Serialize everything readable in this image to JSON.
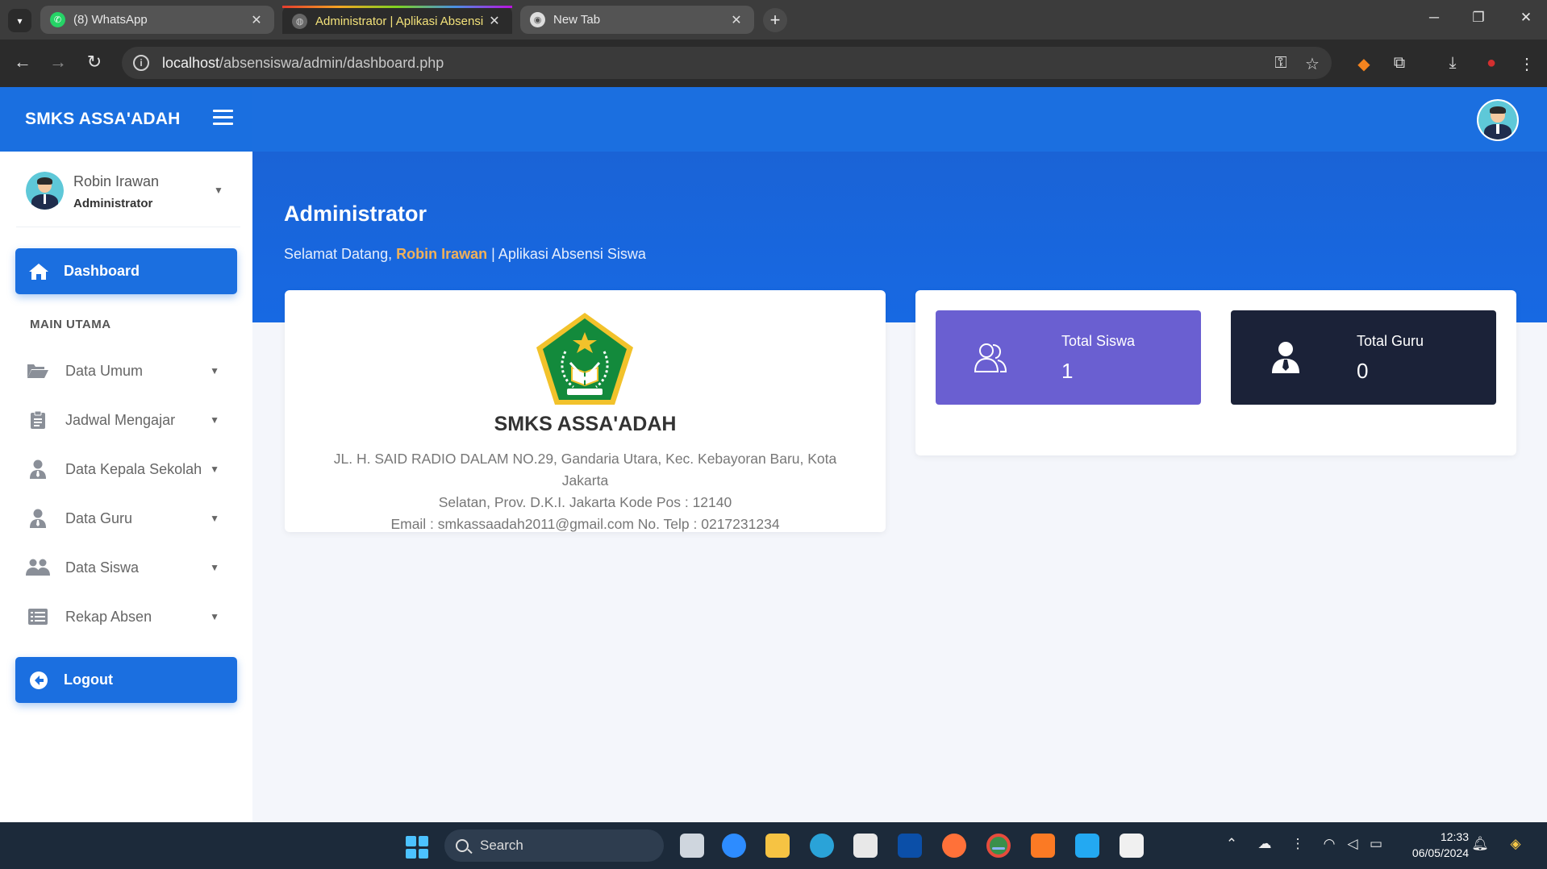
{
  "browser": {
    "tabs": [
      {
        "title": "(8) WhatsApp",
        "icon": "whatsapp-icon"
      },
      {
        "title": "Administrator | Aplikasi Absensi",
        "icon": "globe-icon",
        "active": true
      },
      {
        "title": "New Tab",
        "icon": "chrome-icon"
      }
    ],
    "url_host": "localhost",
    "url_path": "/absensiswa/admin/dashboard.php"
  },
  "app": {
    "brand": "SMKS ASSA'ADAH"
  },
  "sidebar": {
    "user_name": "Robin Irawan",
    "user_role": "Administrator",
    "dashboard_label": "Dashboard",
    "section_label": "MAIN UTAMA",
    "menu": [
      {
        "label": "Data Umum",
        "icon": "folder-open-icon"
      },
      {
        "label": "Jadwal Mengajar",
        "icon": "clipboard-icon"
      },
      {
        "label": "Data Kepala Sekolah",
        "icon": "user-tie-icon"
      },
      {
        "label": "Data Guru",
        "icon": "user-tie-icon"
      },
      {
        "label": "Data Siswa",
        "icon": "users-icon"
      },
      {
        "label": "Rekap Absen",
        "icon": "list-icon"
      }
    ],
    "logout_label": "Logout"
  },
  "content": {
    "title": "Administrator",
    "welcome_prefix": "Selamat Datang,",
    "welcome_name": "Robin Irawan",
    "welcome_suffix": "| Aplikasi Absensi Siswa",
    "school": {
      "name": "SMKS ASSA'ADAH",
      "address_line1": "JL. H. SAID RADIO DALAM NO.29, Gandaria Utara, Kec. Kebayoran Baru, Kota Jakarta",
      "address_line2": "Selatan, Prov. D.K.I. Jakarta Kode Pos : 12140",
      "contact_line": "Email : smkassaadah2011@gmail.com No. Telp : 0217231234"
    },
    "stats": [
      {
        "label": "Total Siswa",
        "value": "1",
        "color": "#6a5fd1"
      },
      {
        "label": "Total Guru",
        "value": "0",
        "color": "#1b2238"
      }
    ]
  },
  "taskbar": {
    "search_placeholder": "Search",
    "time": "12:33",
    "date": "06/05/2024"
  },
  "colors": {
    "primary": "#1b6fe0",
    "highlight": "#f0b15a"
  }
}
